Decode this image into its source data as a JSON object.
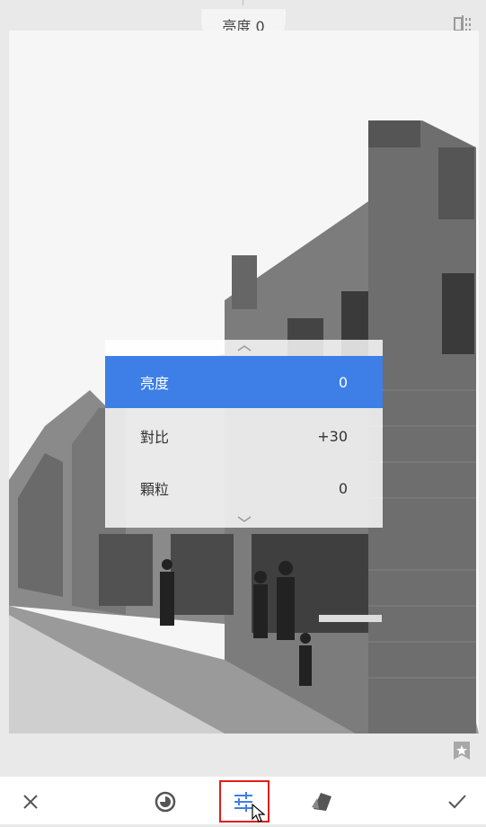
{
  "header": {
    "current_adjustment": "亮度 0"
  },
  "adjust_menu": {
    "items": [
      {
        "label": "亮度",
        "value": "0",
        "active": true
      },
      {
        "label": "對比",
        "value": "+30",
        "active": false
      },
      {
        "label": "顆粒",
        "value": "0",
        "active": false
      }
    ]
  },
  "toolbar": {
    "items": [
      "cancel-icon",
      "looks-icon",
      "tune-icon",
      "export-icon",
      "apply-icon"
    ],
    "highlight_color": "#e21c1c"
  },
  "colors": {
    "accent": "#3d7fe6",
    "background": "#e9e9e9"
  }
}
